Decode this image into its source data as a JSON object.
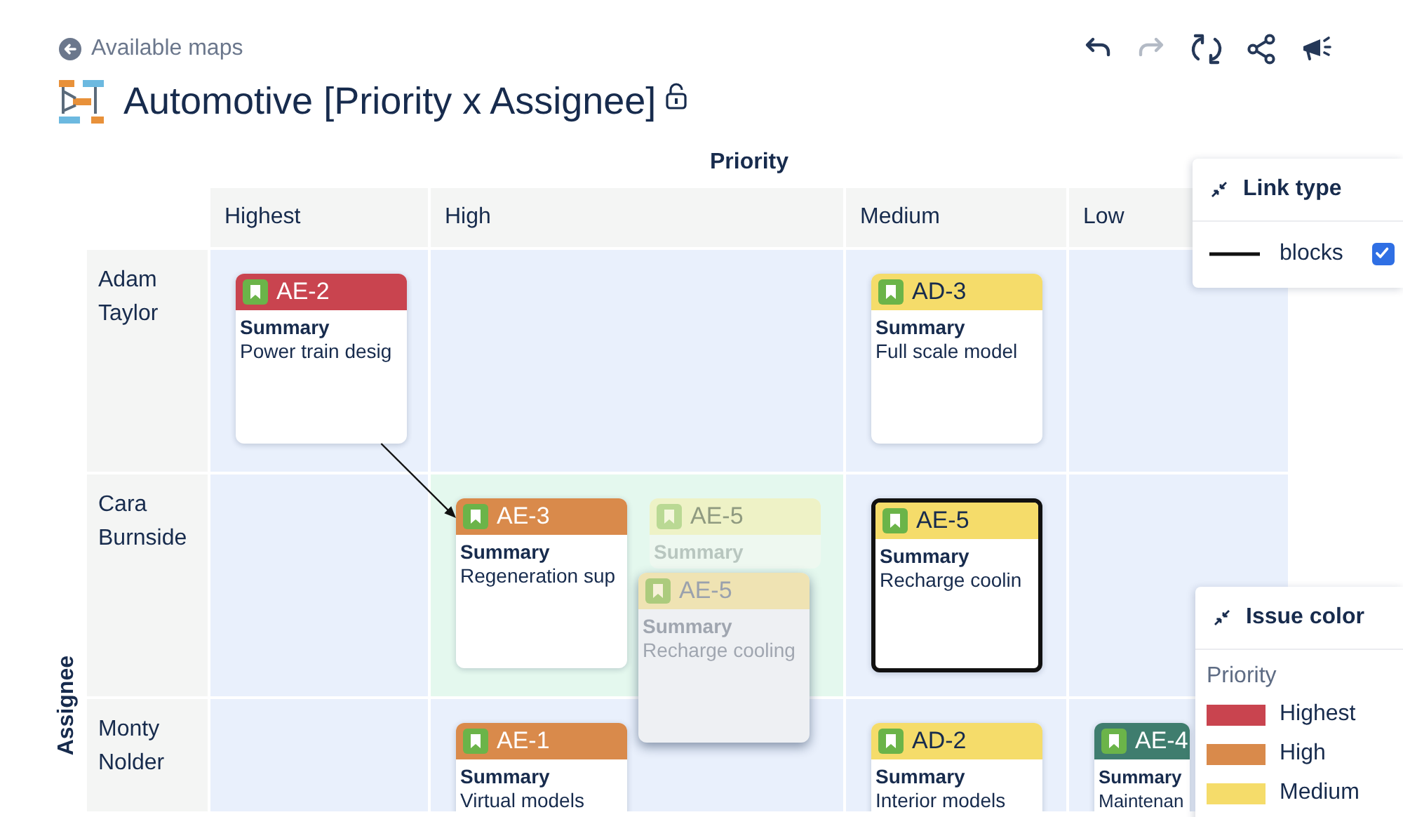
{
  "back_link": {
    "label": "Available maps"
  },
  "title": {
    "text": "Automotive [Priority x Assignee]",
    "locked": false
  },
  "toolbar": [
    {
      "kind": "undo",
      "disabled": false
    },
    {
      "kind": "redo",
      "disabled": true
    },
    {
      "kind": "sync",
      "disabled": false
    },
    {
      "kind": "share",
      "disabled": false
    },
    {
      "kind": "announce",
      "disabled": false
    }
  ],
  "board": {
    "x_axis": "Priority",
    "y_axis": "Assignee",
    "columns": [
      "Highest",
      "High",
      "Medium",
      "Low"
    ],
    "rows": [
      {
        "name": "Adam Taylor",
        "cells": [
          {
            "drop_target": false,
            "cards": [
              {
                "kind": "card",
                "key": "AE-2",
                "color": "#c9444f",
                "label": "Summary",
                "summary": "Power train desig",
                "selected": false,
                "link_out": true
              }
            ]
          },
          {
            "drop_target": false
          },
          {
            "drop_target": false,
            "cards": [
              {
                "kind": "card",
                "key": "AD-3",
                "color": "#f5dc6a",
                "label": "Summary",
                "summary": "Full scale model",
                "selected": false
              }
            ]
          },
          {
            "drop_target": false
          }
        ]
      },
      {
        "name": "Cara Burnside",
        "cells": [
          {
            "drop_target": false
          },
          {
            "drop_target": true,
            "cards": [
              {
                "kind": "card",
                "key": "AE-3",
                "color": "#d98a4b",
                "label": "Summary",
                "summary": "Regeneration sup",
                "selected": false,
                "link_in": true
              },
              {
                "kind": "ghost",
                "key": "AE-5",
                "color": "#eef2c6",
                "label": "Summary",
                "selected": false
              },
              {
                "kind": "dragging",
                "key": "AE-5",
                "color": "#efe3b3",
                "label": "Summary",
                "summary": "Recharge cooling",
                "selected": false
              }
            ]
          },
          {
            "drop_target": false,
            "cards": [
              {
                "kind": "card",
                "key": "AE-5",
                "color": "#f5dc6a",
                "label": "Summary",
                "summary": "Recharge coolin",
                "selected": true
              }
            ]
          },
          {
            "drop_target": false
          }
        ]
      },
      {
        "name": "Monty Nolder",
        "cells": [
          {
            "drop_target": false
          },
          {
            "drop_target": false,
            "cards": [
              {
                "kind": "card",
                "key": "AE-1",
                "color": "#d98a4b",
                "label": "Summary",
                "summary": "Virtual models",
                "selected": false
              }
            ]
          },
          {
            "drop_target": false,
            "cards": [
              {
                "kind": "card",
                "key": "AD-2",
                "color": "#f5dc6a",
                "label": "Summary",
                "summary": "Interior models",
                "selected": false
              }
            ]
          },
          {
            "drop_target": false,
            "cards": [
              {
                "kind": "card",
                "key": "AE-4",
                "color": "#3f7d6e",
                "label": "Summary",
                "summary": "Maintenan",
                "selected": false
              }
            ]
          }
        ]
      }
    ]
  },
  "link_type": {
    "title": "Link type",
    "items": [
      {
        "label": "blocks",
        "checked": true
      }
    ]
  },
  "issue_color": {
    "title": "Issue color",
    "group": "Priority",
    "items": [
      {
        "label": "Highest",
        "color": "#c9444f"
      },
      {
        "label": "High",
        "color": "#d98a4b"
      },
      {
        "label": "Medium",
        "color": "#f5dc6a"
      }
    ]
  }
}
